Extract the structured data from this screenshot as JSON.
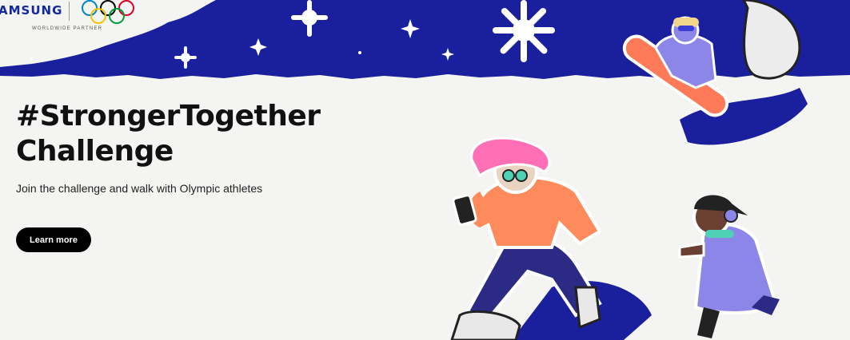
{
  "brand": {
    "name": "AMSUNG",
    "tagline": "WORLDWIDE PARTNER",
    "logo_icon": "olympic-rings-icon"
  },
  "hero": {
    "title_line1": "#StrongerTogether",
    "title_line2": "Challenge",
    "subtitle": "Join the challenge and walk with Olympic athletes",
    "cta_label": "Learn more"
  },
  "colors": {
    "navy": "#1a1f9e",
    "paper": "#f4f4f2",
    "cta_bg": "#000000",
    "orange": "#ff8a5c",
    "pink": "#ff6fb5",
    "lavender": "#8c86e8"
  }
}
